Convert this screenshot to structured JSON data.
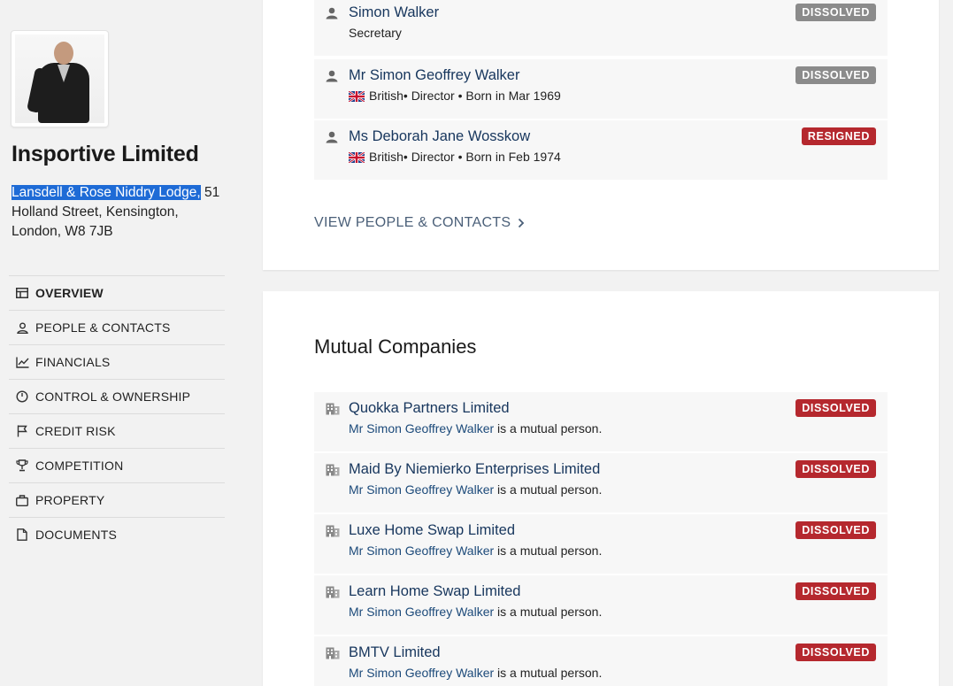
{
  "company": {
    "name": "Insportive Limited",
    "address_selected": "Lansdell & Rose Niddry Lodge,",
    "address_line1_rest": " 51",
    "address_line2": "Holland Street, Kensington,",
    "address_line3": "London, W8 7JB"
  },
  "nav": [
    {
      "label": "OVERVIEW",
      "icon": "overview-icon",
      "active": true
    },
    {
      "label": "PEOPLE & CONTACTS",
      "icon": "person-icon"
    },
    {
      "label": "FINANCIALS",
      "icon": "chart-line-icon"
    },
    {
      "label": "CONTROL & OWNERSHIP",
      "icon": "gauge-icon"
    },
    {
      "label": "CREDIT RISK",
      "icon": "flag-icon"
    },
    {
      "label": "COMPETITION",
      "icon": "trophy-icon"
    },
    {
      "label": "PROPERTY",
      "icon": "briefcase-icon"
    },
    {
      "label": "DOCUMENTS",
      "icon": "document-icon"
    }
  ],
  "people": [
    {
      "name": "Simon Walker",
      "role_line": "Secretary",
      "status": "DISSOLVED"
    },
    {
      "name": "Mr Simon Geoffrey Walker",
      "nationality": "British",
      "role_line": " • Director • Born in Mar 1969",
      "status": "DISSOLVED"
    },
    {
      "name": "Ms Deborah Jane Wosskow",
      "nationality": "British",
      "role_line": " • Director • Born in Feb 1974",
      "status": "RESIGNED"
    }
  ],
  "view_people_label": "VIEW PEOPLE & CONTACTS",
  "mutual": {
    "title": "Mutual Companies",
    "suffix": " is a mutual person.",
    "companies": [
      {
        "name": "Quokka Partners Limited",
        "person": "Mr Simon Geoffrey Walker",
        "status": "DISSOLVED"
      },
      {
        "name": "Maid By Niemierko Enterprises Limited",
        "person": "Mr Simon Geoffrey Walker",
        "status": "DISSOLVED"
      },
      {
        "name": "Luxe Home Swap Limited",
        "person": "Mr Simon Geoffrey Walker",
        "status": "DISSOLVED"
      },
      {
        "name": "Learn Home Swap Limited",
        "person": "Mr Simon Geoffrey Walker",
        "status": "DISSOLVED"
      },
      {
        "name": "BMTV Limited",
        "person": "Mr Simon Geoffrey Walker",
        "status": "DISSOLVED"
      }
    ]
  },
  "colors": {
    "link": "#17365d",
    "dissolved_grey": "#8b8b8b",
    "status_red": "#b5282e",
    "selection": "#1e6bd6"
  }
}
